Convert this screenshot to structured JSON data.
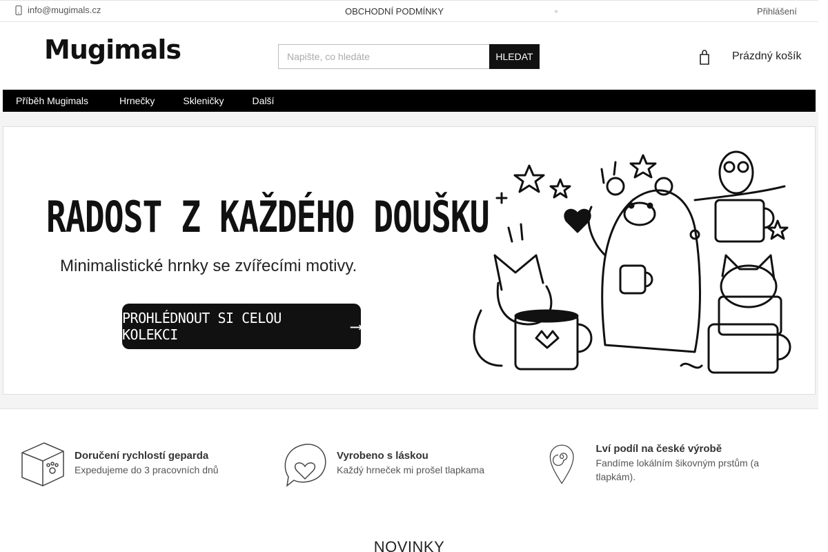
{
  "topbar": {
    "email": "info@mugimals.cz",
    "terms": "OBCHODNÍ PODMÍNKY",
    "login": "Přihlášení"
  },
  "header": {
    "logo": "Mugimals",
    "search_placeholder": "Napište, co hledáte",
    "search_button": "HLEDAT",
    "cart_label": "Prázdný košík"
  },
  "nav": {
    "items": [
      {
        "label": "Příběh Mugimals"
      },
      {
        "label": "Hrnečky"
      },
      {
        "label": "Skleničky"
      },
      {
        "label": "Další"
      }
    ]
  },
  "banner": {
    "headline": "RADOST Z KAŽDÉHO DOUŠKU",
    "subline": "Minimalistické hrnky se zvířecími motivy.",
    "cta": "PROHLÉDNOUT SI CELOU KOLEKCI"
  },
  "features": [
    {
      "title": "Doručení rychlostí geparda",
      "text": "Expedujeme do 3 pracovních dnů",
      "icon": "box-paw-icon"
    },
    {
      "title": "Vyrobeno s láskou",
      "text": "Každý hrneček mi prošel tlapkama",
      "icon": "heart-bubble-icon"
    },
    {
      "title": "Lví podíl na české výrobě",
      "text": "Fandíme lokálním šikovným prstům (a tlapkám).",
      "icon": "location-pin-icon"
    }
  ],
  "section": {
    "title": "NOVINKY"
  }
}
